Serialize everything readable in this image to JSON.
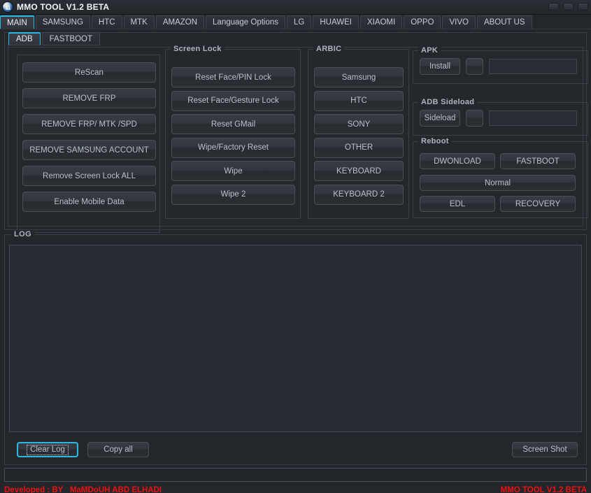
{
  "window": {
    "title": "MMO TOOL V1.2 BETA",
    "app_icon": "app-logo-icon",
    "controls": {
      "minimize": "minimize-icon",
      "maximize": "maximize-icon",
      "close": "close-icon"
    },
    "accent_color": "#2bb8e8",
    "footer_color": "#ee1111"
  },
  "main_tabs": [
    {
      "label": "MAIN",
      "active": true
    },
    {
      "label": "SAMSUNG",
      "active": false
    },
    {
      "label": "HTC",
      "active": false
    },
    {
      "label": "MTK",
      "active": false
    },
    {
      "label": "AMAZON",
      "active": false
    },
    {
      "label": "Language Options",
      "active": false
    },
    {
      "label": "LG",
      "active": false
    },
    {
      "label": "HUAWEI",
      "active": false
    },
    {
      "label": "XIAOMI",
      "active": false
    },
    {
      "label": "OPPO",
      "active": false
    },
    {
      "label": "VIVO",
      "active": false
    },
    {
      "label": "ABOUT US",
      "active": false
    }
  ],
  "sub_tabs": [
    {
      "label": "ADB",
      "active": true
    },
    {
      "label": "FASTBOOT",
      "active": false
    }
  ],
  "left_actions": [
    {
      "label": "ReScan"
    },
    {
      "label": "REMOVE FRP"
    },
    {
      "label": "REMOVE FRP/ MTK /SPD"
    },
    {
      "label": "REMOVE SAMSUNG ACCOUNT"
    },
    {
      "label": "Remove Screen Lock ALL"
    },
    {
      "label": "Enable Mobile Data"
    }
  ],
  "screen_lock": {
    "legend": "Screen Lock",
    "buttons": [
      {
        "label": "Reset Face/PIN Lock"
      },
      {
        "label": "Reset Face/Gesture Lock"
      },
      {
        "label": "Reset GMail"
      },
      {
        "label": "Wipe/Factory Reset"
      },
      {
        "label": "Wipe"
      },
      {
        "label": "Wipe 2"
      }
    ]
  },
  "arbic": {
    "legend": "ARBIC",
    "buttons": [
      {
        "label": "Samsung"
      },
      {
        "label": "HTC"
      },
      {
        "label": "SONY"
      },
      {
        "label": "OTHER"
      },
      {
        "label": "KEYBOARD"
      },
      {
        "label": "KEYBOARD 2"
      }
    ]
  },
  "apk": {
    "legend": "APK",
    "action_label": "Install",
    "browse_label": "",
    "path_value": "",
    "path_placeholder": ""
  },
  "adb_sideload": {
    "legend": "ADB Sideload",
    "action_label": "Sideload",
    "browse_label": "",
    "path_value": "",
    "path_placeholder": ""
  },
  "reboot": {
    "legend": "Reboot",
    "buttons": [
      {
        "label": "DWONLOAD"
      },
      {
        "label": "FASTBOOT"
      },
      {
        "label": "Normal"
      },
      {
        "label": "EDL"
      },
      {
        "label": "RECOVERY"
      }
    ]
  },
  "log": {
    "legend": "LOG",
    "content": "",
    "clear_label": "Clear Log",
    "copy_label": "Copy all",
    "screenshot_label": "Screen Shot"
  },
  "status": {
    "text": ""
  },
  "footer": {
    "developer": "Developed : BY_ MaMDoUH ABD ELHADI",
    "version": "MMO TOOL V1.2 BETA"
  }
}
